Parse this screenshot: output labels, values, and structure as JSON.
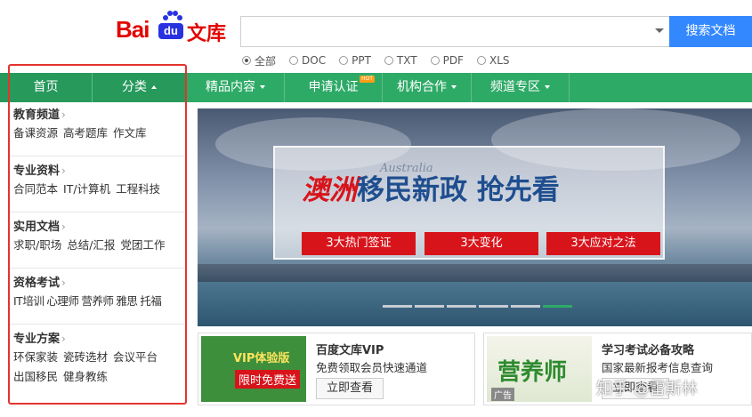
{
  "logo": {
    "bai": "Bai",
    "du": "du",
    "wenku": "文库"
  },
  "search": {
    "value": "",
    "button_label": "搜索文档"
  },
  "filetypes": [
    {
      "label": "全部",
      "selected": true
    },
    {
      "label": "DOC",
      "selected": false
    },
    {
      "label": "PPT",
      "selected": false
    },
    {
      "label": "TXT",
      "selected": false
    },
    {
      "label": "PDF",
      "selected": false
    },
    {
      "label": "XLS",
      "selected": false
    }
  ],
  "nav": {
    "items": [
      "首页",
      "分类",
      "精品内容",
      "申请认证",
      "机构合作",
      "频道专区"
    ],
    "hot_badge": "HOT"
  },
  "sidebar": {
    "categories": [
      {
        "title": "教育频道",
        "links": [
          "备课资源",
          "高考题库",
          "作文库"
        ]
      },
      {
        "title": "专业资料",
        "links": [
          "合同范本",
          "IT/计算机",
          "工程科技"
        ]
      },
      {
        "title": "实用文档",
        "links": [
          "求职/职场",
          "总结/汇报",
          "党团工作"
        ]
      },
      {
        "title": "资格考试",
        "links": [
          "IT培训",
          "心理师",
          "营养师",
          "雅思",
          "托福"
        ]
      },
      {
        "title": "专业方案",
        "links": [
          "环保家装",
          "瓷砖选材",
          "会议平台",
          "出国移民",
          "健身教练"
        ]
      }
    ]
  },
  "banner": {
    "title_red": "澳洲",
    "title_blue": "移民新政  抢先看",
    "subtitle": "Australia",
    "buttons": [
      "3大热门签证",
      "3大变化",
      "3大应对之法"
    ],
    "active_slide": 6,
    "slide_count": 6
  },
  "cards": [
    {
      "title": "百度文库VIP",
      "subtitle": "免费领取会员快速通道",
      "button": "立即查看",
      "thumb_line1": "VIP体验版",
      "thumb_line2": "限时免费送"
    },
    {
      "title": "学习考试必备攻略",
      "subtitle": "国家最新报考信息查询",
      "button": "立即查看",
      "thumb_text": "营养师",
      "ad_label": "广告"
    }
  ],
  "watermark": "知乎 @雷斯林",
  "colors": {
    "nav_green": "#2eaa67",
    "search_blue": "#3388ff",
    "baidu_red": "#e10602",
    "highlight_red": "#e3342f"
  }
}
